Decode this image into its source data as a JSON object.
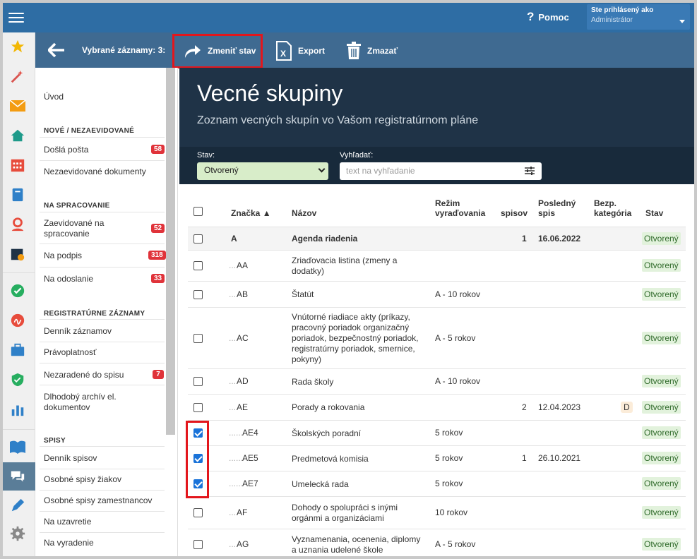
{
  "topbar": {
    "help_label": "Pomoc",
    "user_label": "Ste prihlásený ako",
    "user_name": "Administrátor"
  },
  "actionbar": {
    "selected_label": "Vybrané záznamy: 3:",
    "change_state_label": "Zmeniť stav",
    "export_label": "Export",
    "delete_label": "Zmazať"
  },
  "sidebar": {
    "intro": "Úvod",
    "sec_new": "NOVÉ / NEZAEVIDOVANÉ",
    "incoming": "Došlá pošta",
    "incoming_count": "58",
    "unregistered": "Nezaevidované dokumenty",
    "sec_processing": "NA SPRACOVANIE",
    "registered_processing": "Zaevidované na spracovanie",
    "registered_processing_count": "52",
    "to_sign": "Na podpis",
    "to_sign_count": "318",
    "to_send": "Na odoslanie",
    "to_send_count": "33",
    "sec_records": "REGISTRATÚRNE ZÁZNAMY",
    "record_journal": "Denník záznamov",
    "validity": "Právoplatnosť",
    "not_in_file": "Nezaradené do spisu",
    "not_in_file_count": "7",
    "archive": "Dlhodobý archív el. dokumentov",
    "sec_files": "SPISY",
    "file_journal": "Denník spisov",
    "student_files": "Osobné spisy žiakov",
    "employee_files": "Osobné spisy zamestnancov",
    "to_close": "Na uzavretie",
    "to_discard": "Na vyradenie"
  },
  "header": {
    "title": "Vecné skupiny",
    "subtitle": "Zoznam vecných skupín vo Vašom registratúrnom pláne"
  },
  "filters": {
    "state_label": "Stav:",
    "state_value": "Otvorený",
    "search_label": "Vyhľadať:",
    "search_placeholder": "text na vyhľadanie"
  },
  "table": {
    "headers": {
      "code": "Značka ▲",
      "name": "Názov",
      "mode": "Režim vyraďovania",
      "files": "spisov",
      "last_file": "Posledný spis",
      "security": "Bezp. kategória",
      "state": "Stav"
    },
    "rows": [
      {
        "code": "A",
        "dots": "",
        "name": "Agenda riadenia",
        "mode": "",
        "files": "1",
        "last": "16.06.2022",
        "sec": "",
        "state": "Otvorený",
        "checked": false
      },
      {
        "code": "AA",
        "dots": "...",
        "name": "Zriaďovacia listina (zmeny a dodatky)",
        "mode": "",
        "files": "",
        "last": "",
        "sec": "",
        "state": "Otvorený",
        "checked": false
      },
      {
        "code": "AB",
        "dots": "...",
        "name": "Štatút",
        "mode": "A - 10 rokov",
        "files": "",
        "last": "",
        "sec": "",
        "state": "Otvorený",
        "checked": false
      },
      {
        "code": "AC",
        "dots": "...",
        "name": "Vnútorné riadiace akty (príkazy, pracovný poriadok organizačný poriadok, bezpečnostný poriadok, registratúrny poriadok, smernice, pokyny)",
        "mode": "A - 5 rokov",
        "files": "",
        "last": "",
        "sec": "",
        "state": "Otvorený",
        "checked": false
      },
      {
        "code": "AD",
        "dots": "...",
        "name": "Rada školy",
        "mode": "A - 10 rokov",
        "files": "",
        "last": "",
        "sec": "",
        "state": "Otvorený",
        "checked": false
      },
      {
        "code": "AE",
        "dots": "...",
        "name": "Porady a rokovania",
        "mode": "",
        "files": "2",
        "last": "12.04.2023",
        "sec": "D",
        "state": "Otvorený",
        "checked": false
      },
      {
        "code": "AE4",
        "dots": "......",
        "name": "Školských poradní",
        "mode": "5 rokov",
        "files": "",
        "last": "",
        "sec": "",
        "state": "Otvorený",
        "checked": true
      },
      {
        "code": "AE5",
        "dots": "......",
        "name": "Predmetová komisia",
        "mode": "5 rokov",
        "files": "1",
        "last": "26.10.2021",
        "sec": "",
        "state": "Otvorený",
        "checked": true
      },
      {
        "code": "AE7",
        "dots": "......",
        "name": "Umelecká rada",
        "mode": "5 rokov",
        "files": "",
        "last": "",
        "sec": "",
        "state": "Otvorený",
        "checked": true
      },
      {
        "code": "AF",
        "dots": "...",
        "name": "Dohody o spolupráci s inými orgánmi a organizáciami",
        "mode": "10 rokov",
        "files": "",
        "last": "",
        "sec": "",
        "state": "Otvorený",
        "checked": false
      },
      {
        "code": "AG",
        "dots": "...",
        "name": "Vyznamenania, ocenenia, diplomy a uznania udelené škole",
        "mode": "A - 5 rokov",
        "files": "",
        "last": "",
        "sec": "",
        "state": "Otvorený",
        "checked": false
      }
    ]
  },
  "colors": {
    "topbar": "#2e6da4",
    "actionbar": "#3f6a91",
    "header": "#1f3347",
    "highlight": "#e3161c",
    "badge": "#e0333a"
  }
}
